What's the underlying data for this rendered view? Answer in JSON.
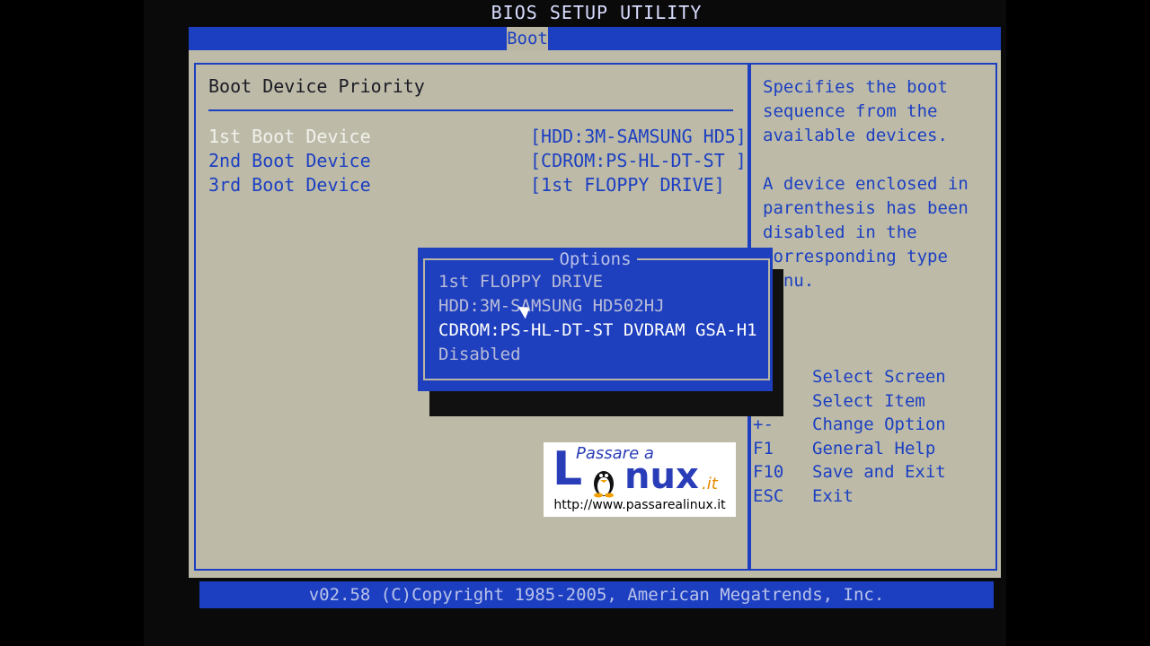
{
  "header": {
    "title": "BIOS SETUP UTILITY",
    "tab": "Boot"
  },
  "section": {
    "title": "Boot Device Priority"
  },
  "boot_devices": [
    {
      "label": "1st Boot Device",
      "value": "[HDD:3M-SAMSUNG HD5]"
    },
    {
      "label": "2nd Boot Device",
      "value": "[CDROM:PS-HL-DT-ST ]"
    },
    {
      "label": "3rd Boot Device",
      "value": "[1st FLOPPY DRIVE]"
    }
  ],
  "help": {
    "p1": "Specifies the boot sequence from the available devices.",
    "p2": "A device enclosed in parenthesis has been disabled in the corresponding type menu."
  },
  "keys": [
    {
      "key": "",
      "action": "Select Screen"
    },
    {
      "key": "↑↓",
      "action": "Select Item"
    },
    {
      "key": "+-",
      "action": "Change Option"
    },
    {
      "key": "F1",
      "action": "General Help"
    },
    {
      "key": "F10",
      "action": "Save and Exit"
    },
    {
      "key": "ESC",
      "action": "Exit"
    }
  ],
  "popup": {
    "title": "Options",
    "options": [
      "1st FLOPPY DRIVE",
      "HDD:3M-SAMSUNG HD502HJ",
      "CDROM:PS-HL-DT-ST DVDRAM GSA-H1",
      "Disabled"
    ]
  },
  "footer": {
    "text": "v02.58 (C)Copyright 1985-2005, American Megatrends, Inc."
  },
  "watermark": {
    "line1": "Passare a",
    "brand_l": "L",
    "brand_nux": "nux",
    "brand_tld": ".it",
    "url": "http://www.passarealinux.it"
  }
}
